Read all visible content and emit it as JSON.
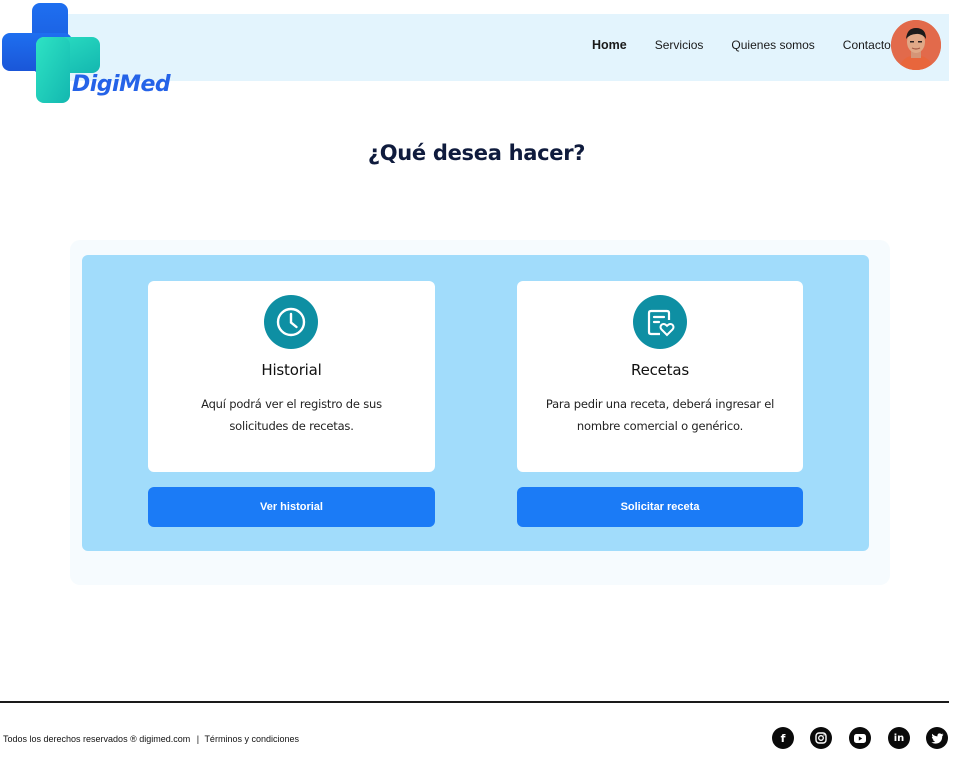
{
  "brand": {
    "name": "DigiMed",
    "logo_icon": "medical-cross-logo"
  },
  "nav": {
    "items": [
      {
        "label": "Home",
        "active": true
      },
      {
        "label": "Servicios",
        "active": false
      },
      {
        "label": "Quienes somos",
        "active": false
      },
      {
        "label": "Contacto",
        "active": false
      }
    ],
    "avatar_icon": "user-avatar"
  },
  "main": {
    "title": "¿Qué desea hacer?",
    "cards": [
      {
        "icon": "clock-icon",
        "title": "Historial",
        "description": "Aquí podrá ver el registro de sus solicitudes de recetas.",
        "button": "Ver historial"
      },
      {
        "icon": "prescription-heart-icon",
        "title": "Recetas",
        "description": "Para pedir una receta, deberá ingresar el nombre comercial o genérico.",
        "button": "Solicitar receta"
      }
    ]
  },
  "footer": {
    "copyright": "Todos los derechos reservados ® digimed.com",
    "separator": "|",
    "terms": "Términos y condiciones",
    "social": [
      "facebook-icon",
      "instagram-icon",
      "youtube-icon",
      "linkedin-icon",
      "twitter-icon"
    ],
    "social_glyphs": {
      "facebook": "f",
      "linkedin": "in"
    }
  },
  "colors": {
    "accent": "#1b7bf6",
    "panel": "#a1dcfb",
    "navbar": "#e3f4fd",
    "icon_bg": "#0e8fa3",
    "title": "#0f1b3d"
  }
}
